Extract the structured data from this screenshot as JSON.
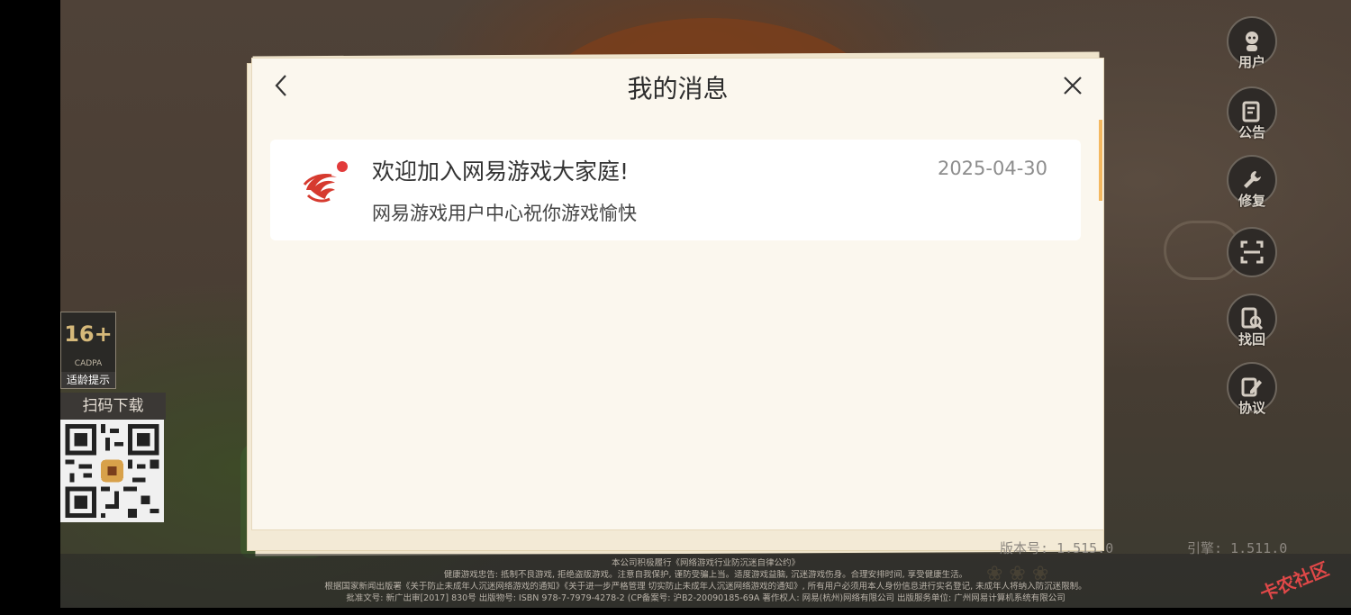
{
  "dialog": {
    "title": "我的消息",
    "messages": [
      {
        "title": "欢迎加入网易游戏大家庭!",
        "date": "2025-04-30",
        "body": "网易游戏用户中心祝你游戏愉快"
      }
    ]
  },
  "side_buttons": [
    {
      "label": "用户",
      "icon": "user-icon"
    },
    {
      "label": "公告",
      "icon": "announcement-icon"
    },
    {
      "label": "修复",
      "icon": "wrench-icon"
    },
    {
      "label": "",
      "icon": "scan-icon"
    },
    {
      "label": "找回",
      "icon": "recover-icon"
    },
    {
      "label": "协议",
      "icon": "agreement-icon"
    }
  ],
  "age_rating": {
    "age": "16+",
    "org": "CADPA",
    "tip": "适龄提示"
  },
  "qr": {
    "title": "扫码下载"
  },
  "versions": {
    "left": "版本号: 1.515.0",
    "right": "引擎: 1.511.0"
  },
  "legal_lines": [
    "本公司积极履行《网络游戏行业防沉迷自律公约》",
    "健康游戏忠告: 抵制不良游戏, 拒绝盗版游戏。注意自我保护, 谨防受骗上当。适度游戏益脑, 沉迷游戏伤身。合理安排时间, 享受健康生活。",
    "根据国家新闻出版署《关于防止未成年人沉迷网络游戏的通知》《关于进一步严格管理 切实防止未成年人沉迷网络游戏的通知》, 所有用户必须用本人身份信息进行实名登记, 未成年人将纳入防沉迷限制。",
    "批准文号: 新广出审[2017] 830号 出版物号: ISBN 978-7-7979-4278-2 (CP备案号: 沪B2-20090185-69A 著作权人: 网易(杭州)网络有限公司 出版服务单位: 广州网易计算机系统有限公司"
  ],
  "watermark": "卡农社区",
  "colors": {
    "accent_orange": "#f4b860",
    "logo_red": "#e23b3b",
    "dialog_bg": "#fbf7ee"
  }
}
